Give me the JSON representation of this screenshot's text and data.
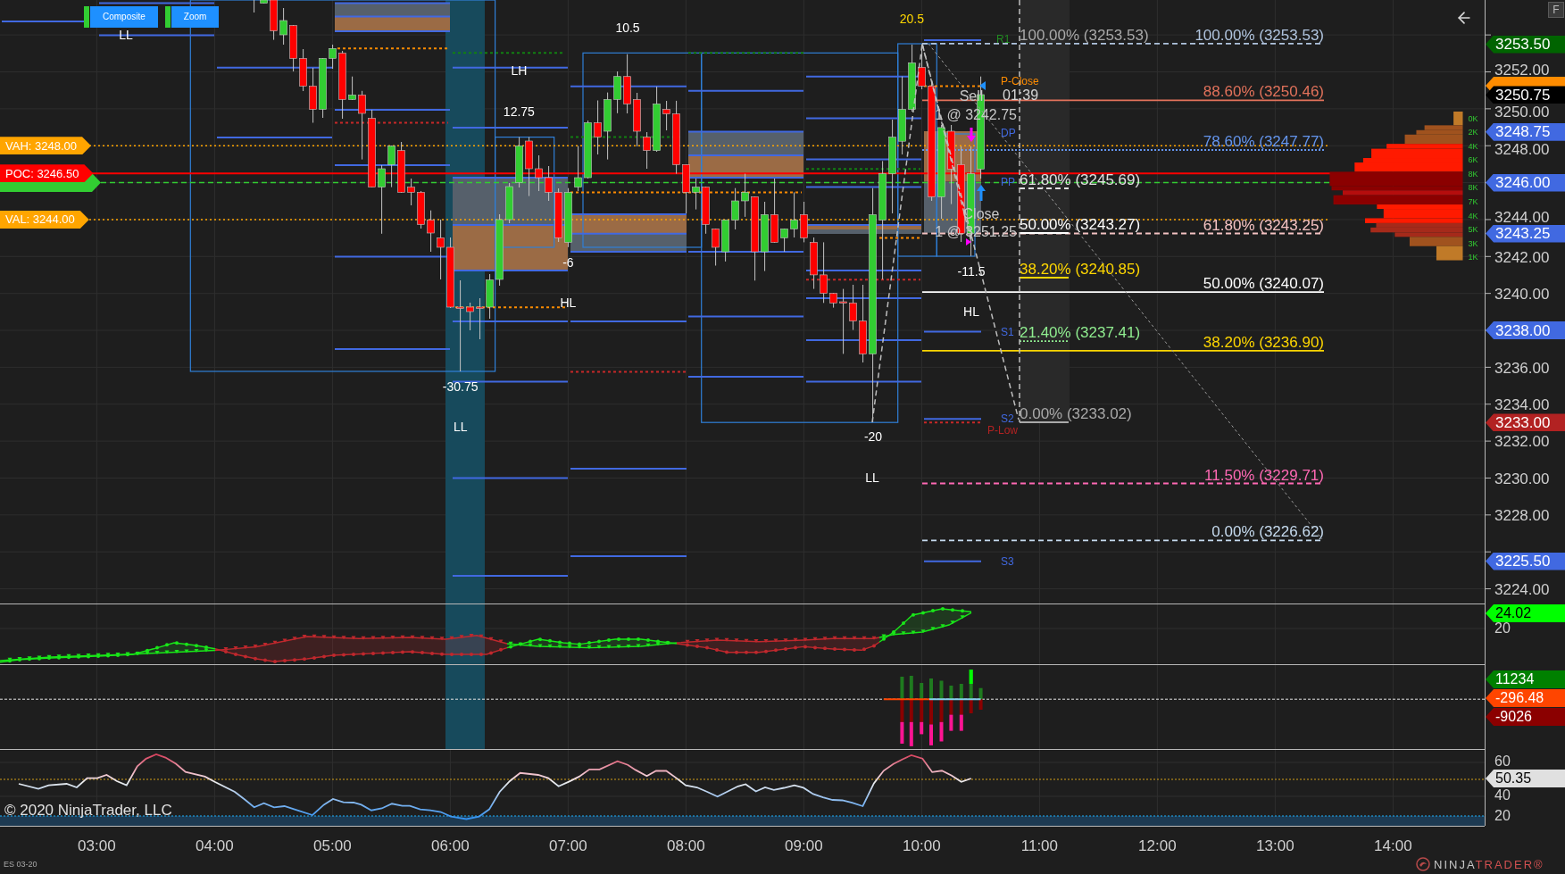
{
  "toolbar": {
    "buttons": [
      {
        "label": "Composite",
        "active": true
      },
      {
        "label": "Zoom",
        "active": true
      }
    ],
    "corner_button": "F"
  },
  "price_panel": {
    "level_tags": [
      {
        "label": "VAH: 3248.00",
        "color": "#ffa500"
      },
      {
        "label": "POC: 3246.50",
        "color": "#ff0000"
      },
      {
        "label": "VAL: 3244.00",
        "color": "#ffa500"
      }
    ],
    "swing_labels": [
      {
        "text": "LL",
        "color": "#ffffff"
      },
      {
        "text": "-30.75",
        "color": "#ffffff"
      },
      {
        "text": "LL",
        "color": "#ffffff"
      },
      {
        "text": "LH",
        "color": "#ffffff"
      },
      {
        "text": "12.75",
        "color": "#ffffff"
      },
      {
        "text": "-6",
        "color": "#ffffff"
      },
      {
        "text": "HL",
        "color": "#ffffff"
      },
      {
        "text": "10.5",
        "color": "#ffffff"
      },
      {
        "text": "20.5",
        "color": "#ffd700"
      },
      {
        "text": "-20",
        "color": "#ffffff"
      },
      {
        "text": "LL",
        "color": "#ffffff"
      },
      {
        "text": "-11.5",
        "color": "#ffffff"
      },
      {
        "text": "HL",
        "color": "#ffffff"
      }
    ],
    "pivot_labels": [
      {
        "text": "R1",
        "color": "#228b22"
      },
      {
        "text": "P-Close",
        "color": "#ff8c00"
      },
      {
        "text": "DP",
        "color": "#4169e1"
      },
      {
        "text": "PP",
        "color": "#4169e1"
      },
      {
        "text": "S1",
        "color": "#4169e1"
      },
      {
        "text": "S2",
        "color": "#4169e1"
      },
      {
        "text": "P-Low",
        "color": "#b22222"
      },
      {
        "text": "S3",
        "color": "#4169e1"
      }
    ],
    "orders": [
      {
        "action": "Sell",
        "fill": "1 @ 3242.75"
      },
      {
        "action": "Close",
        "fill": "1 @ 3251.25"
      }
    ],
    "bar_timer": "01:39",
    "fib_retracement_1": [
      {
        "label": "100.00% (3253.53)",
        "color": "#a9a9a9"
      },
      {
        "label": "61.80% (3245.69)",
        "color": "#e0e0e0"
      },
      {
        "label": "50.00% (3243.27)",
        "color": "#ffffff"
      },
      {
        "label": "38.20% (3240.85)",
        "color": "#ffd700"
      },
      {
        "label": "21.40% (3237.41)",
        "color": "#90ee90"
      },
      {
        "label": "0.00% (3233.02)",
        "color": "#a9a9a9"
      }
    ],
    "fib_retracement_2": [
      {
        "label": "100.00% (3253.53)",
        "color": "#b0c4de"
      },
      {
        "label": "88.60% (3250.46)",
        "color": "#e2725b"
      },
      {
        "label": "78.60% (3247.77)",
        "color": "#6495ed"
      },
      {
        "label": "61.80% (3243.25)",
        "color": "#f4c2c2"
      },
      {
        "label": "50.00% (3240.07)",
        "color": "#ffffff"
      },
      {
        "label": "38.20% (3236.90)",
        "color": "#ffd700"
      },
      {
        "label": "11.50% (3229.71)",
        "color": "#ff69b4"
      },
      {
        "label": "0.00% (3226.62)",
        "color": "#c6dbef"
      }
    ],
    "volume_profile": {
      "labels": [
        "0K",
        "2K",
        "4K",
        "6K",
        "8K",
        "8K",
        "7K",
        "4K",
        "5K",
        "3K",
        "1K"
      ]
    }
  },
  "price_axis": {
    "ticks": [
      "3252.00",
      "3250.00",
      "3248.00",
      "3244.00",
      "3242.00",
      "3240.00",
      "3236.00",
      "3234.00",
      "3232.00",
      "3230.00",
      "3228.00",
      "3224.00"
    ],
    "tags": [
      {
        "label": "3253.50",
        "color": "#006400"
      },
      {
        "label": "3250.75",
        "color": "#000000"
      },
      {
        "label": "3248.75",
        "color": "#4169e1"
      },
      {
        "label": "3246.00",
        "color": "#4169e1"
      },
      {
        "label": "3243.25",
        "color": "#4169e1"
      },
      {
        "label": "3238.00",
        "color": "#4169e1"
      },
      {
        "label": "3233.00",
        "color": "#b22222"
      },
      {
        "label": "3225.50",
        "color": "#4169e1"
      }
    ]
  },
  "indicator_1": {
    "ticks": [
      "20"
    ],
    "tags": [
      {
        "label": "24.02",
        "color": "#00ff00"
      }
    ]
  },
  "indicator_2": {
    "tags": [
      {
        "label": "11234",
        "color": "#008000"
      },
      {
        "label": "-296.48",
        "color": "#ff4500"
      },
      {
        "label": "-9026",
        "color": "#8b0000"
      }
    ]
  },
  "indicator_3": {
    "copyright": "© 2020 NinjaTrader, LLC",
    "ticks": [
      "60",
      "40",
      "20"
    ],
    "tags": [
      {
        "label": "50.35",
        "color": "#e0e0e0"
      }
    ]
  },
  "time_axis": {
    "labels": [
      "03:00",
      "04:00",
      "05:00",
      "06:00",
      "07:00",
      "08:00",
      "09:00",
      "10:00",
      "11:00",
      "12:00",
      "13:00",
      "14:00"
    ]
  },
  "footer": {
    "instrument": "ES 03-20",
    "logo": [
      "NINJA",
      "TRADER®"
    ]
  }
}
